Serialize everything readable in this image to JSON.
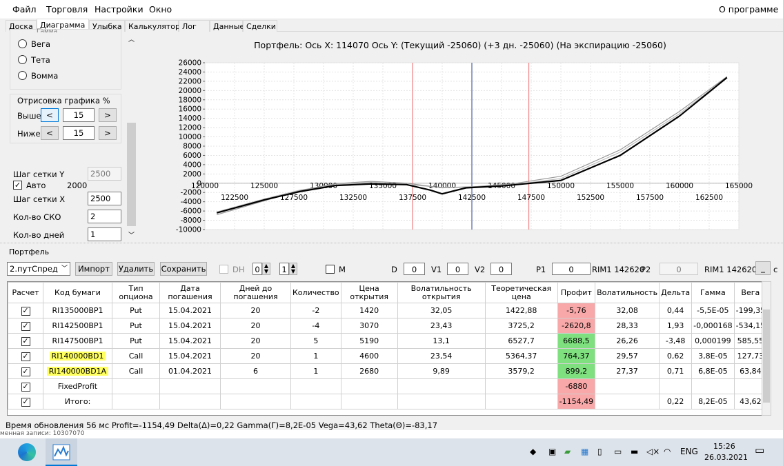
{
  "menu": [
    "Файл",
    "Торговля",
    "Настройки",
    "Окно"
  ],
  "about": "О программе",
  "tabs": [
    "Доска",
    "Диаграмма",
    "Улыбка",
    "Калькулятор",
    "Лог",
    "Данные",
    "Сделки"
  ],
  "left": {
    "radio_cut": "Гамма",
    "radios": [
      "Вега",
      "Тета",
      "Вомма"
    ],
    "draw_group": "Отрисовка графика %",
    "above_label": "Выше",
    "above_value": "15",
    "below_label": "Ниже",
    "below_value": "15",
    "left_arrow": "<",
    "right_arrow": ">",
    "grid_y_label": "Шаг сетки Y",
    "grid_y_value": "2500",
    "auto_label": "Авто",
    "auto_value": "2000",
    "grid_x_label": "Шаг сетки X",
    "grid_x_value": "2500",
    "sko_label": "Кол-во СКО",
    "sko_value": "2",
    "days_label": "Кол-во дней",
    "days_value": "1"
  },
  "chart": {
    "title": "Портфель: Ось X: 114070 Ось Y:  (Текущий -25060)  (+3 дн. -25060)  (На экспирацию -25060)"
  },
  "chart_data": {
    "type": "line",
    "title": "Портфель: Ось X: 114070 Ось Y:  (Текущий -25060)  (+3 дн. -25060)  (На экспирацию -25060)",
    "xlim": [
      120000,
      165000
    ],
    "ylim": [
      -10000,
      26000
    ],
    "x_ticks_top": [
      "120000",
      "125000",
      "130000",
      "135000",
      "140000",
      "145000",
      "150000",
      "155000",
      "160000",
      "165000"
    ],
    "x_ticks_bottom": [
      "122500",
      "127500",
      "132500",
      "137500",
      "142500",
      "147500",
      "152500",
      "157500",
      "162500"
    ],
    "y_ticks": [
      "26000",
      "24000",
      "22000",
      "20000",
      "18000",
      "16000",
      "14000",
      "12000",
      "10000",
      "8000",
      "6000",
      "4000",
      "2000",
      "0",
      "-2000",
      "-4000",
      "-6000",
      "-8000",
      "-10000"
    ],
    "vlines": [
      {
        "x": 137500,
        "color": "#f08080"
      },
      {
        "x": 142500,
        "color": "#5060a0"
      },
      {
        "x": 147300,
        "color": "#f08080"
      }
    ],
    "series": [
      {
        "x": [
          121000,
          125000,
          128000,
          131000,
          134000,
          137000,
          139000,
          140000,
          142000,
          145000,
          150000,
          155000,
          160000,
          164000
        ],
        "values": [
          -6400,
          -3600,
          -1800,
          -500,
          -150,
          -300,
          -1500,
          -2300,
          -1000,
          -600,
          600,
          6000,
          14500,
          22800
        ],
        "color": "#000000"
      },
      {
        "x": [
          121000,
          125000,
          128000,
          131000,
          134000,
          137000,
          140000,
          143000,
          146000,
          150000,
          155000,
          160000,
          164000
        ],
        "values": [
          -6800,
          -3800,
          -1600,
          -100,
          400,
          0,
          -1000,
          -700,
          -100,
          1500,
          7200,
          15500,
          23000
        ],
        "color": "#999999"
      },
      {
        "x": [
          121000,
          125000,
          128000,
          131000,
          134000,
          137000,
          140000,
          143000,
          146000,
          150000,
          155000,
          160000,
          164000
        ],
        "values": [
          -6200,
          -3400,
          -1500,
          -300,
          200,
          -300,
          -900,
          -800,
          -300,
          1000,
          6700,
          15000,
          22800
        ],
        "color": "#bbbbbb"
      }
    ]
  },
  "portfolio_label": "Портфель",
  "toolbar": {
    "combo": "2.путСпред",
    "import": "Импорт",
    "delete": "Удалить",
    "save": "Сохранить",
    "dh": "DH",
    "spin1": "0",
    "spin2": "1",
    "m": "M",
    "d": "D",
    "d_value": "0",
    "v1": "V1",
    "v1_value": "0",
    "v2": "V2",
    "v2_value": "0",
    "p1": "P1",
    "p1_value": "0",
    "rim1": "RIM1 142620",
    "p2": "P2",
    "p2_value": "0",
    "rim2": "RIM1 142620",
    "underscore": "_",
    "c": "c"
  },
  "table": {
    "headers": [
      "Расчет",
      "Код бумаги",
      "Тип опциона",
      "Дата погашения",
      "Дней до погашения",
      "Количество",
      "Цена открытия",
      "Волатильность открытия",
      "Теоретическая цена",
      "Профит",
      "Волатильность",
      "Дельта",
      "Гамма",
      "Вега"
    ],
    "rows": [
      [
        "✓",
        "RI135000BP1",
        "Put",
        "15.04.2021",
        "20",
        "-2",
        "1420",
        "32,05",
        "1422,88",
        "-5,76",
        "32,08",
        "0,44",
        "-5,5E-05",
        "-199,35"
      ],
      [
        "✓",
        "RI142500BP1",
        "Put",
        "15.04.2021",
        "20",
        "-4",
        "3070",
        "23,43",
        "3725,2",
        "-2620,8",
        "28,33",
        "1,93",
        "-0,000168",
        "-534,15"
      ],
      [
        "✓",
        "RI147500BP1",
        "Put",
        "15.04.2021",
        "20",
        "5",
        "5190",
        "13,1",
        "6527,7",
        "6688,5",
        "26,26",
        "-3,48",
        "0,000199",
        "585,55"
      ],
      [
        "✓",
        "RI140000BD1",
        "Call",
        "15.04.2021",
        "20",
        "1",
        "4600",
        "23,54",
        "5364,37",
        "764,37",
        "29,57",
        "0,62",
        "3,8E-05",
        "127,73"
      ],
      [
        "✓",
        "RI140000BD1A",
        "Call",
        "01.04.2021",
        "6",
        "1",
        "2680",
        "9,89",
        "3579,2",
        "899,2",
        "27,37",
        "0,71",
        "6,8E-05",
        "63,84"
      ],
      [
        "✓",
        "FixedProfit",
        "",
        "",
        "",
        "",
        "",
        "",
        "",
        "-6880",
        "",
        "",
        "",
        ""
      ],
      [
        "✓",
        "Итого:",
        "",
        "",
        "",
        "",
        "",
        "",
        "",
        "-1154,49",
        "",
        "0,22",
        "8,2E-05",
        "43,62"
      ]
    ],
    "profit_status": [
      "neg",
      "neg",
      "pos",
      "pos",
      "pos",
      "neg",
      "neg"
    ],
    "highlight_rows": [
      3,
      4
    ]
  },
  "status": "Время обновления 56 мс  Profit=-1154,49 Delta(Δ)=0,22 Gamma(Γ)=8,2E-05 Vega=43,62 Theta(Θ)=-83,17",
  "bg_text": "менная записи: 10307070",
  "taskbar": {
    "lang": "ENG",
    "time": "15:26",
    "date": "26.03.2021"
  }
}
